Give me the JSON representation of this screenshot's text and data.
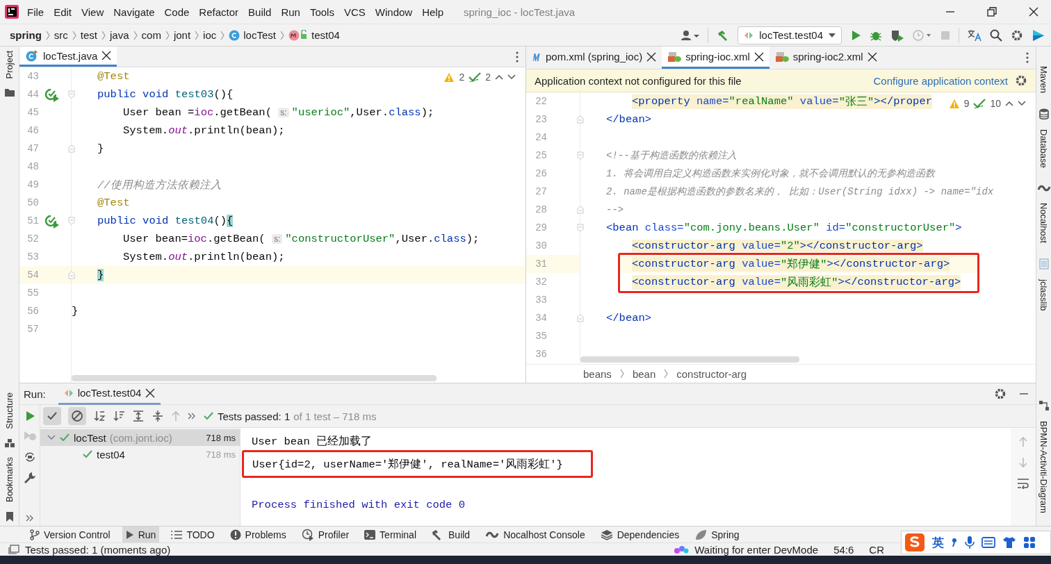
{
  "title_bar": {
    "menu": [
      "File",
      "Edit",
      "View",
      "Navigate",
      "Code",
      "Refactor",
      "Build",
      "Run",
      "Tools",
      "VCS",
      "Window",
      "Help"
    ],
    "title": "spring_ioc - locTest.java"
  },
  "navigation_bar": {
    "breadcrumbs": [
      {
        "label": "spring",
        "kind": "project"
      },
      {
        "label": "src",
        "kind": "folder"
      },
      {
        "label": "test",
        "kind": "folder"
      },
      {
        "label": "java",
        "kind": "folder"
      },
      {
        "label": "com",
        "kind": "folder"
      },
      {
        "label": "jont",
        "kind": "folder"
      },
      {
        "label": "ioc",
        "kind": "folder"
      },
      {
        "label": "locTest",
        "kind": "class"
      },
      {
        "label": "test04",
        "kind": "method"
      }
    ],
    "run_configuration": "locTest.test04"
  },
  "left_stripe": {
    "top": [
      "Project"
    ],
    "bottom": [
      "Structure",
      "Bookmarks"
    ]
  },
  "editor_left": {
    "tabs": [
      {
        "label": "locTest.java",
        "kind": "java",
        "selected": true
      }
    ],
    "warnings": "2",
    "checks": "2",
    "lines": [
      {
        "n": "43",
        "kind": "member",
        "tokens": [
          {
            "kind": "ann",
            "text": "@Test"
          }
        ]
      },
      {
        "n": "44",
        "run": true,
        "fold_start": true,
        "kind": "member",
        "tokens": [
          {
            "kind": "kw",
            "text": "public void "
          },
          {
            "kind": "fn",
            "text": "test03"
          },
          {
            "kind": "p",
            "text": "(){"
          }
        ]
      },
      {
        "n": "45",
        "kind": "statement",
        "tokens": [
          {
            "kind": "p",
            "text": "User bean ="
          },
          {
            "kind": "field",
            "text": "ioc"
          },
          {
            "kind": "p",
            "text": ".getBean( "
          },
          {
            "kind": "hint",
            "text": "s:"
          },
          {
            "kind": "str",
            "text": "\"userioc\""
          },
          {
            "kind": "p",
            "text": ",User."
          },
          {
            "kind": "kw",
            "text": "class"
          },
          {
            "kind": "p",
            "text": ");"
          }
        ]
      },
      {
        "n": "46",
        "kind": "statement",
        "tokens": [
          {
            "kind": "p",
            "text": "System."
          },
          {
            "kind": "static",
            "text": "out"
          },
          {
            "kind": "p",
            "text": ".println(bean);"
          }
        ]
      },
      {
        "n": "47",
        "fold_end": true,
        "kind": "member",
        "tokens": [
          {
            "kind": "p",
            "text": "}"
          }
        ]
      },
      {
        "n": "48"
      },
      {
        "n": "49",
        "kind": "member",
        "tokens": [
          {
            "kind": "comment",
            "text": "//使用构造方法依赖注入"
          }
        ]
      },
      {
        "n": "50",
        "kind": "member",
        "tokens": [
          {
            "kind": "ann",
            "text": "@Test"
          }
        ]
      },
      {
        "n": "51",
        "run": true,
        "fold_start": true,
        "kind": "member",
        "tokens": [
          {
            "kind": "kw",
            "text": "public void "
          },
          {
            "kind": "fn",
            "text": "test04"
          },
          {
            "kind": "p",
            "text": "()"
          },
          {
            "kind": "brace",
            "text": "{"
          }
        ]
      },
      {
        "n": "52",
        "kind": "statement",
        "tokens": [
          {
            "kind": "p",
            "text": "User bean="
          },
          {
            "kind": "field",
            "text": "ioc"
          },
          {
            "kind": "p",
            "text": ".getBean( "
          },
          {
            "kind": "hint",
            "text": "s:"
          },
          {
            "kind": "str",
            "text": "\"constructorUser\""
          },
          {
            "kind": "p",
            "text": ",User."
          },
          {
            "kind": "kw",
            "text": "class"
          },
          {
            "kind": "p",
            "text": ");"
          }
        ]
      },
      {
        "n": "53",
        "kind": "statement",
        "tokens": [
          {
            "kind": "p",
            "text": "System."
          },
          {
            "kind": "static",
            "text": "out"
          },
          {
            "kind": "p",
            "text": ".println(bean);"
          }
        ]
      },
      {
        "n": "54",
        "current": true,
        "fold_end": true,
        "kind": "member",
        "tokens": [
          {
            "kind": "brace",
            "text": "}"
          }
        ]
      },
      {
        "n": "55"
      },
      {
        "n": "56",
        "tokens": [
          {
            "kind": "p",
            "text": "}"
          }
        ]
      },
      {
        "n": "57"
      }
    ]
  },
  "editor_right": {
    "tabs": [
      {
        "label": "pom.xml (spring_ioc)",
        "kind": "maven",
        "selected": false
      },
      {
        "label": "spring-ioc.xml",
        "kind": "xml",
        "selected": true
      },
      {
        "label": "spring-ioc2.xml",
        "kind": "xml",
        "selected": false
      }
    ],
    "banner": {
      "message": "Application context not configured for this file",
      "link": "Configure application context"
    },
    "warnings": "9",
    "checks": "10",
    "lines": [
      {
        "n": "22",
        "marked": true,
        "kind": "child",
        "tokens": [
          {
            "kind": "tag",
            "text": "<property "
          },
          {
            "kind": "attr",
            "text": "name="
          },
          {
            "kind": "str",
            "text": "\"realName\" "
          },
          {
            "kind": "attr",
            "text": "value="
          },
          {
            "kind": "str",
            "text": "\"张三\""
          },
          {
            "kind": "tag",
            "text": "></proper"
          }
        ]
      },
      {
        "n": "23",
        "fold_end": true,
        "kind": "element",
        "tokens": [
          {
            "kind": "tag",
            "text": "</bean>"
          }
        ]
      },
      {
        "n": "24"
      },
      {
        "n": "25",
        "fold_start": true,
        "kind": "element",
        "tokens": [
          {
            "kind": "comment",
            "text": "<!--基于构造函数的依赖注入"
          }
        ]
      },
      {
        "n": "26",
        "kind": "element",
        "tokens": [
          {
            "kind": "comment",
            "text": "1. 将会调用自定义构造函数来实例化对象，就不会调用默认的无参构造函数"
          }
        ]
      },
      {
        "n": "27",
        "kind": "element",
        "tokens": [
          {
            "kind": "comment",
            "text": "2. name是根据构造函数的参数名来的， 比如：User(String idxx) -> name=\"idx"
          }
        ]
      },
      {
        "n": "28",
        "fold_end": true,
        "kind": "element",
        "tokens": [
          {
            "kind": "comment",
            "text": "-->"
          }
        ]
      },
      {
        "n": "29",
        "fold_start": true,
        "kind": "element",
        "tokens": [
          {
            "kind": "tag",
            "text": "<bean "
          },
          {
            "kind": "attr",
            "text": "class="
          },
          {
            "kind": "str",
            "text": "\"com.jony.beans.User\" "
          },
          {
            "kind": "attr",
            "text": "id="
          },
          {
            "kind": "str",
            "text": "\"constructorUser\""
          },
          {
            "kind": "tag",
            "text": ">"
          }
        ]
      },
      {
        "n": "30",
        "marked": true,
        "kind": "child",
        "tokens": [
          {
            "kind": "tag",
            "text": "<constructor-arg "
          },
          {
            "kind": "attr",
            "text": "value="
          },
          {
            "kind": "str",
            "text": "\"2\""
          },
          {
            "kind": "tag",
            "text": "></constructor-arg>"
          }
        ]
      },
      {
        "n": "31",
        "marked": true,
        "current": true,
        "boxed": true,
        "kind": "child",
        "tokens": [
          {
            "kind": "tag",
            "text": "<constructor-arg "
          },
          {
            "kind": "attr",
            "text": "value="
          },
          {
            "kind": "str",
            "text": "\"郑伊健\""
          },
          {
            "kind": "tag",
            "text": "></constructor-arg>"
          }
        ]
      },
      {
        "n": "32",
        "marked": true,
        "boxed": true,
        "kind": "child",
        "tokens": [
          {
            "kind": "tag",
            "text": "<constructor-arg "
          },
          {
            "kind": "attr",
            "text": "value="
          },
          {
            "kind": "str",
            "text": "\"风雨彩虹\""
          },
          {
            "kind": "tag",
            "text": "></constructor-arg>"
          }
        ]
      },
      {
        "n": "33"
      },
      {
        "n": "34",
        "fold_end": true,
        "kind": "element",
        "tokens": [
          {
            "kind": "tag",
            "text": "</bean>"
          }
        ]
      },
      {
        "n": "35"
      },
      {
        "n": "36"
      }
    ],
    "breadcrumbs": [
      "beans",
      "bean",
      "constructor-arg"
    ]
  },
  "right_stripe": [
    "Maven",
    "Database",
    "Nocalhost",
    "jclasslib",
    "BPMN-Activiti-Diagram"
  ],
  "run_panel": {
    "label": "Run:",
    "tab": "locTest.test04",
    "summary": "Tests passed: 1",
    "summary_detail": "of 1 test – 718 ms",
    "tree": [
      {
        "label": "locTest",
        "detail": "(com.jont.ioc)",
        "time": "718 ms",
        "expanded": true,
        "selected": true,
        "children": [
          {
            "label": "test04",
            "time": "718 ms",
            "selected": false
          }
        ]
      }
    ],
    "console": [
      {
        "kind": "stdout",
        "text": "User bean 已经加载了"
      },
      {
        "kind": "stdout",
        "text": "User{id=2, userName='郑伊健', realName='风雨彩虹'}",
        "boxed": true
      },
      {
        "kind": "system",
        "text": "Process finished with exit code 0"
      }
    ]
  },
  "tool_window_bar": [
    {
      "label": "Version Control",
      "kind": "vcs",
      "selected": false
    },
    {
      "label": "Run",
      "kind": "run",
      "selected": true
    },
    {
      "label": "TODO",
      "kind": "todo",
      "selected": false
    },
    {
      "label": "Problems",
      "kind": "problems",
      "selected": false
    },
    {
      "label": "Profiler",
      "kind": "profiler",
      "selected": false
    },
    {
      "label": "Terminal",
      "kind": "terminal",
      "selected": false
    },
    {
      "label": "Build",
      "kind": "build",
      "selected": false
    },
    {
      "label": "Nocalhost Console",
      "kind": "nocalhost",
      "selected": false
    },
    {
      "label": "Dependencies",
      "kind": "dependencies",
      "selected": false
    },
    {
      "label": "Spring",
      "kind": "spring",
      "selected": false
    }
  ],
  "status_bar": {
    "message": "Tests passed: 1 (moments ago)",
    "devmode": "Waiting for enter DevMode",
    "position": "54:6",
    "line_separator": "CR"
  },
  "ime_toolbar": {
    "mode": "英"
  }
}
